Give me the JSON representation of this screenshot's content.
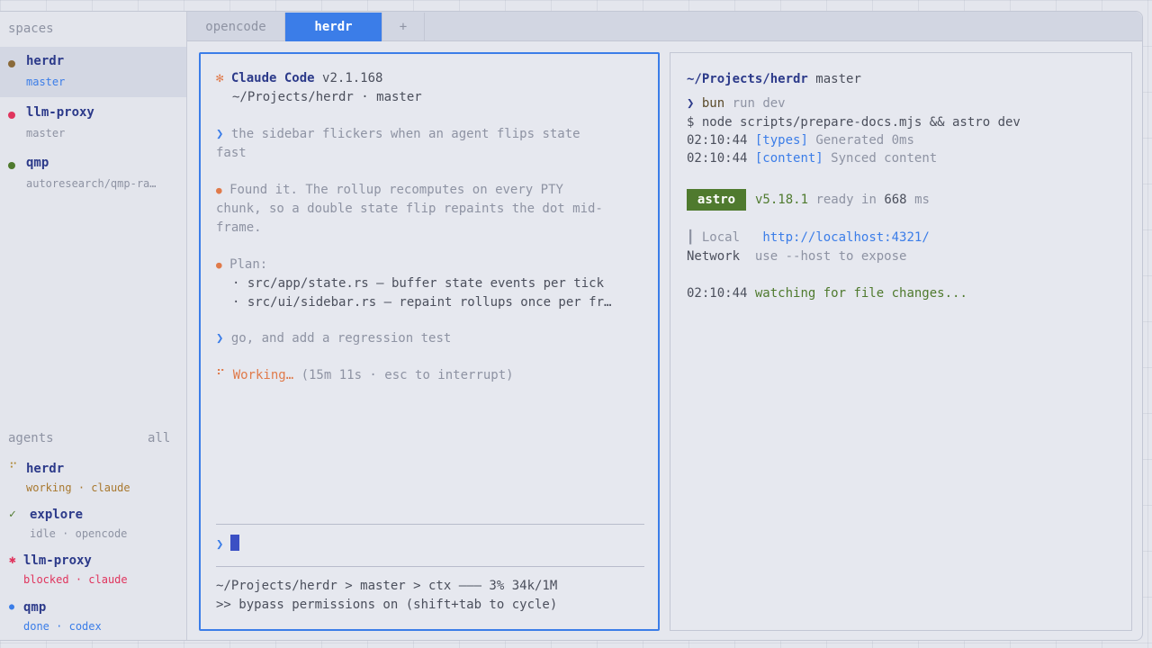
{
  "sidebar": {
    "spaces_title": "spaces",
    "spaces": [
      {
        "name": "herdr",
        "branch": "master",
        "dot_color": "#8a6a3a"
      },
      {
        "name": "llm-proxy",
        "branch": "master",
        "dot_color": "#e0355e"
      },
      {
        "name": "qmp",
        "branch": "autoresearch/qmp-ra…",
        "dot_color": "#4f7a2e"
      }
    ],
    "agents_title": "agents",
    "agents_filter": "all",
    "agents": [
      {
        "mark": "⠋",
        "name": "herdr",
        "state": "working",
        "sep": "·",
        "tool": "claude",
        "mark_color": "#b08a3a",
        "status_color": "#a8782e"
      },
      {
        "mark": "✓",
        "name": "explore",
        "state": "idle",
        "sep": "·",
        "tool": "opencode",
        "mark_color": "#4f7a2e",
        "status_color": "#8e93a3"
      },
      {
        "mark": "✱",
        "name": "llm-proxy",
        "state": "blocked",
        "sep": "·",
        "tool": "claude",
        "mark_color": "#e0355e",
        "status_color": "#e0355e"
      },
      {
        "mark": "●",
        "name": "qmp",
        "state": "done",
        "sep": "·",
        "tool": "codex",
        "mark_color": "#3b7de8",
        "status_color": "#3b7de8"
      }
    ]
  },
  "tabs": [
    {
      "label": "opencode"
    },
    {
      "label": "herdr"
    },
    {
      "label": "+"
    }
  ],
  "left_pane": {
    "header_icon": "✻",
    "app_name": "Claude Code",
    "version": "v2.1.168",
    "cwd": "~/Projects/herdr · master",
    "prompt_glyph": "❯",
    "bullet_glyph": "●",
    "user_msg_1_l1": "the sidebar flickers when an agent flips state",
    "user_msg_1_l2": "fast",
    "resp_1_l1": "Found it. The rollup recomputes on every PTY",
    "resp_1_l2": "chunk, so a double state flip repaints the dot mid-",
    "resp_1_l3": "frame.",
    "plan_title": "Plan:",
    "plan_1": "· src/app/state.rs — buffer state events per tick",
    "plan_2": "· src/ui/sidebar.rs — repaint rollups once per fr…",
    "user_msg_2": "go, and add a regression test",
    "spinner": "⠋",
    "working": "Working…",
    "working_detail": "(15m 11s · esc to interrupt)",
    "status_1": "~/Projects/herdr > master > ctx ——— 3% 34k/1M",
    "status_2": ">> bypass permissions on (shift+tab to cycle)"
  },
  "right_pane": {
    "path": "~/Projects/herdr",
    "branch": "master",
    "prompt_glyph": "❯",
    "cmd": "bun",
    "cmd_args": "run dev",
    "exec_line": "$ node scripts/prepare-docs.mjs && astro dev",
    "log_1_time": "02:10:44",
    "log_1_tag": "[types]",
    "log_1_msg": "Generated 0ms",
    "log_2_time": "02:10:44",
    "log_2_tag": "[content]",
    "log_2_msg": "Synced content",
    "badge": "astro",
    "astro_version": "v5.18.1",
    "ready_text": "ready in",
    "ready_ms": "668",
    "ready_unit": "ms",
    "local_label": "┃ Local",
    "local_url": "http://localhost:4321/",
    "network_label": "Network",
    "network_value": "use --host to expose",
    "watch_time": "02:10:44",
    "watch_msg": "watching for file changes..."
  }
}
